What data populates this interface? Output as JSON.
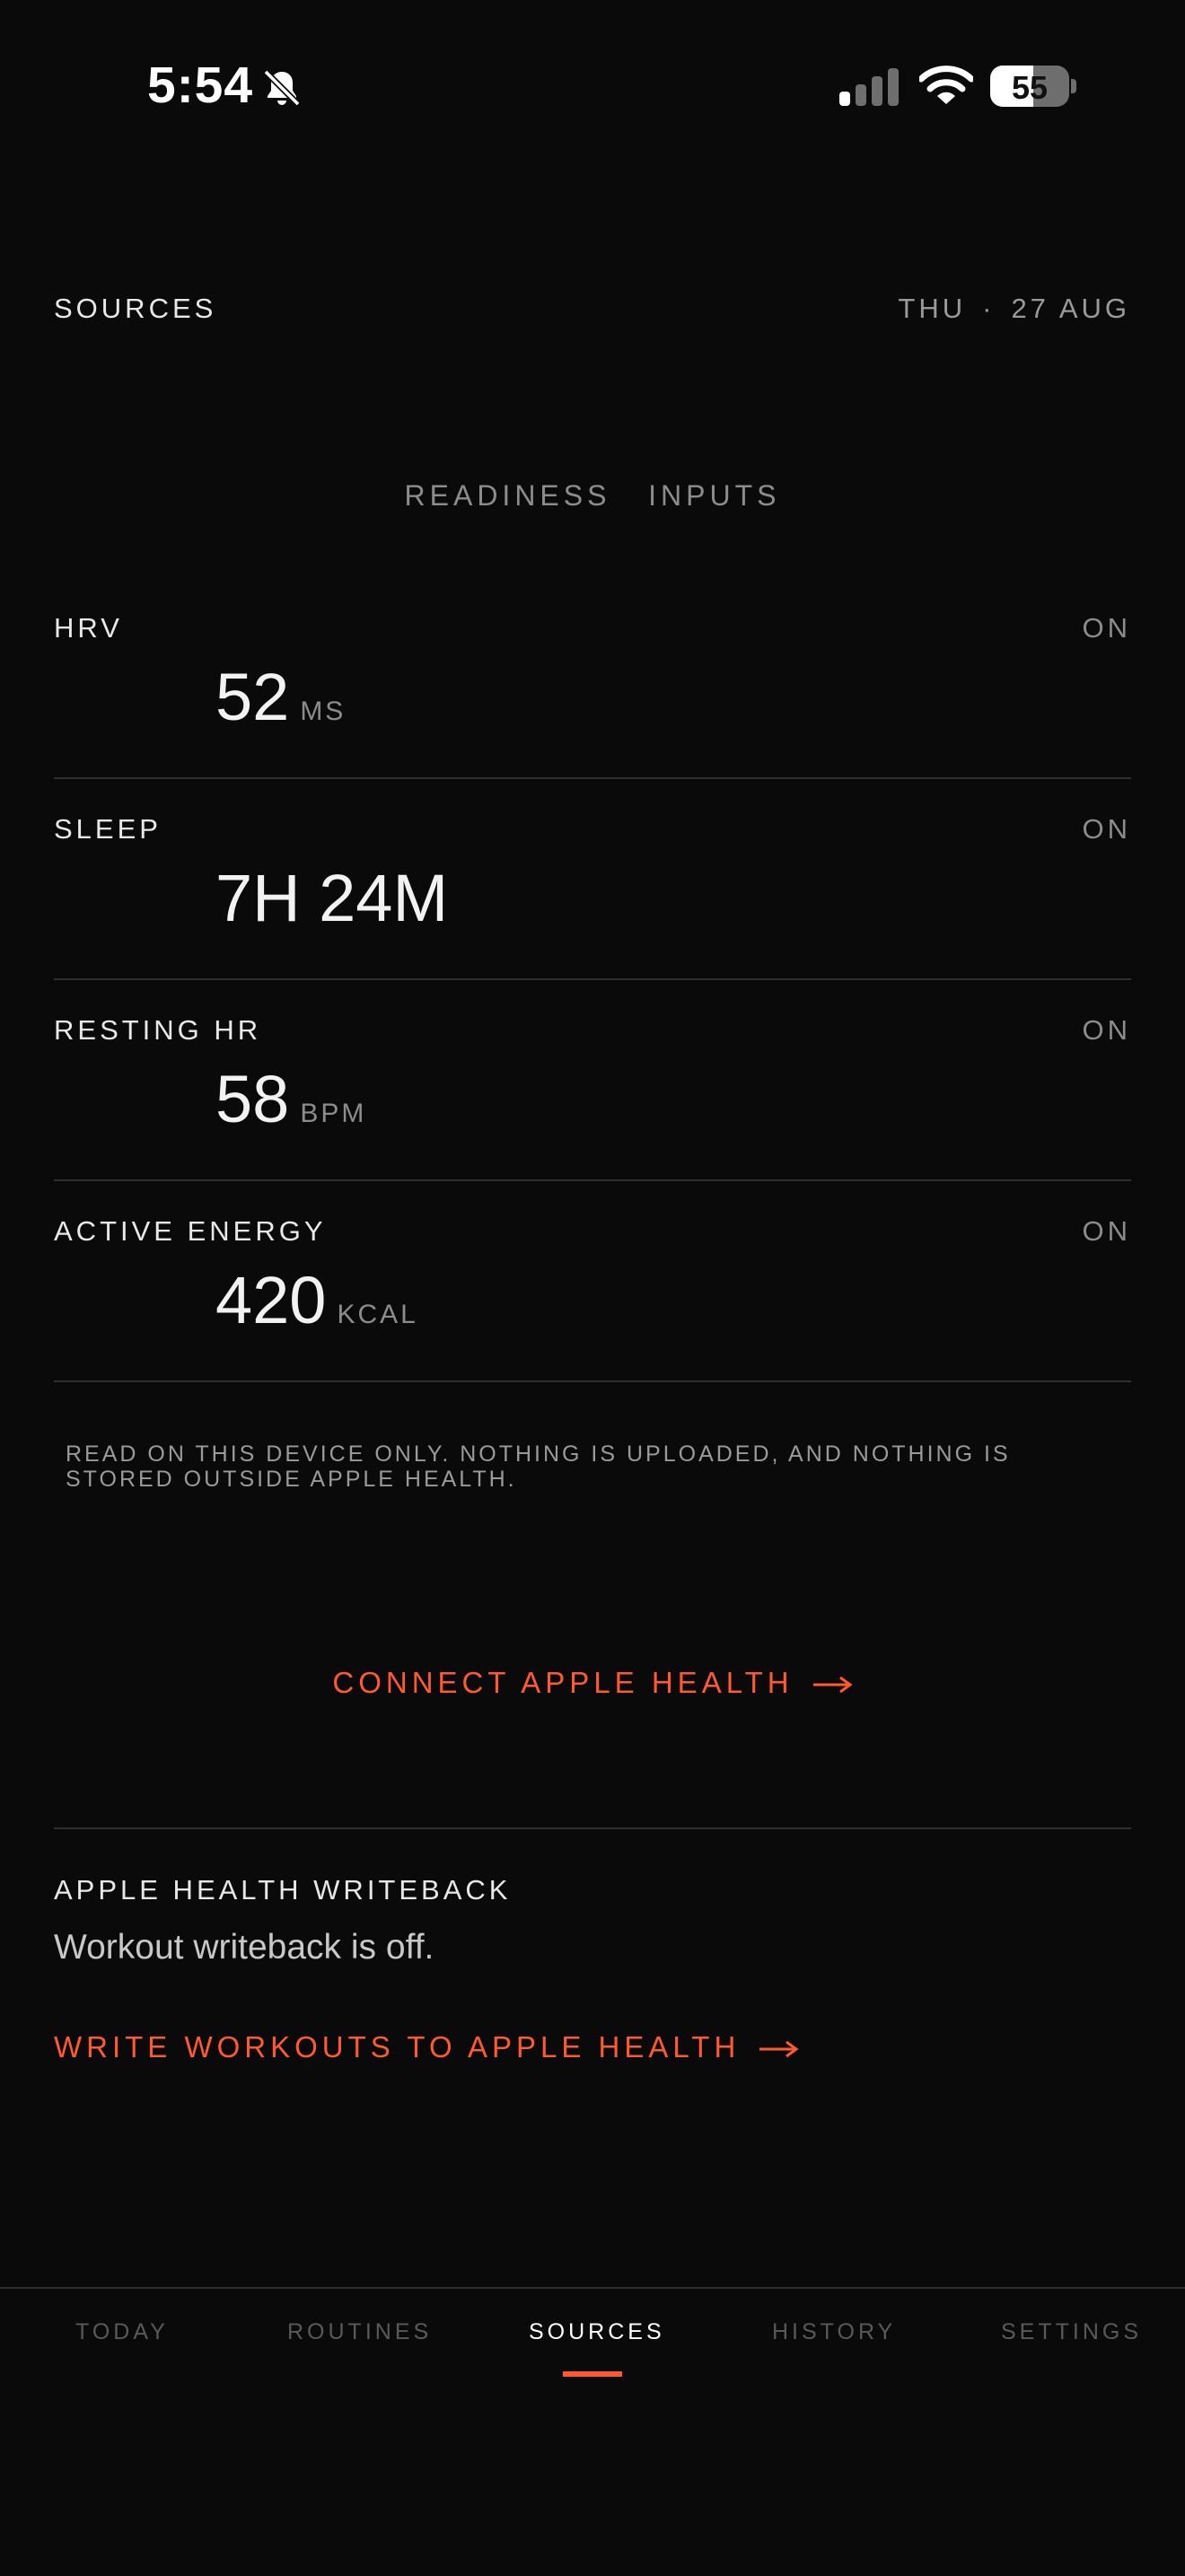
{
  "status_bar": {
    "time": "5:54",
    "battery": "55",
    "battery_level": 0.55
  },
  "header": {
    "title": "SOURCES",
    "day": "THU",
    "separator": "·",
    "date": "27 AUG"
  },
  "subheader": "READINESS   INPUTS",
  "metrics": [
    {
      "label": "HRV",
      "value": "52",
      "unit": "MS",
      "status": "ON"
    },
    {
      "label": "SLEEP",
      "value": "7H 24M",
      "unit": "",
      "status": "ON"
    },
    {
      "label": "RESTING HR",
      "value": "58",
      "unit": "BPM",
      "status": "ON"
    },
    {
      "label": "ACTIVE ENERGY",
      "value": "420",
      "unit": "KCAL",
      "status": "ON"
    }
  ],
  "privacy_note": "READ ON THIS DEVICE ONLY. NOTHING IS UPLOADED, AND NOTHING IS STORED OUTSIDE APPLE HEALTH.",
  "connect_label": "CONNECT APPLE HEALTH",
  "writeback": {
    "title": "APPLE HEALTH WRITEBACK",
    "status": "Workout writeback is off.",
    "link_label": "WRITE WORKOUTS TO APPLE HEALTH"
  },
  "tabs": [
    {
      "label": "TODAY"
    },
    {
      "label": "ROUTINES"
    },
    {
      "label": "SOURCES",
      "active": true
    },
    {
      "label": "HISTORY"
    },
    {
      "label": "SETTINGS"
    }
  ],
  "colors": {
    "background": "#0a0a0a",
    "accent": "#ff5a2d",
    "muted": "#8c8c8c"
  },
  "icons": [
    "bell-muted-icon",
    "cellular-signal-icon",
    "wifi-icon",
    "battery-icon",
    "arrow-right-icon"
  ]
}
